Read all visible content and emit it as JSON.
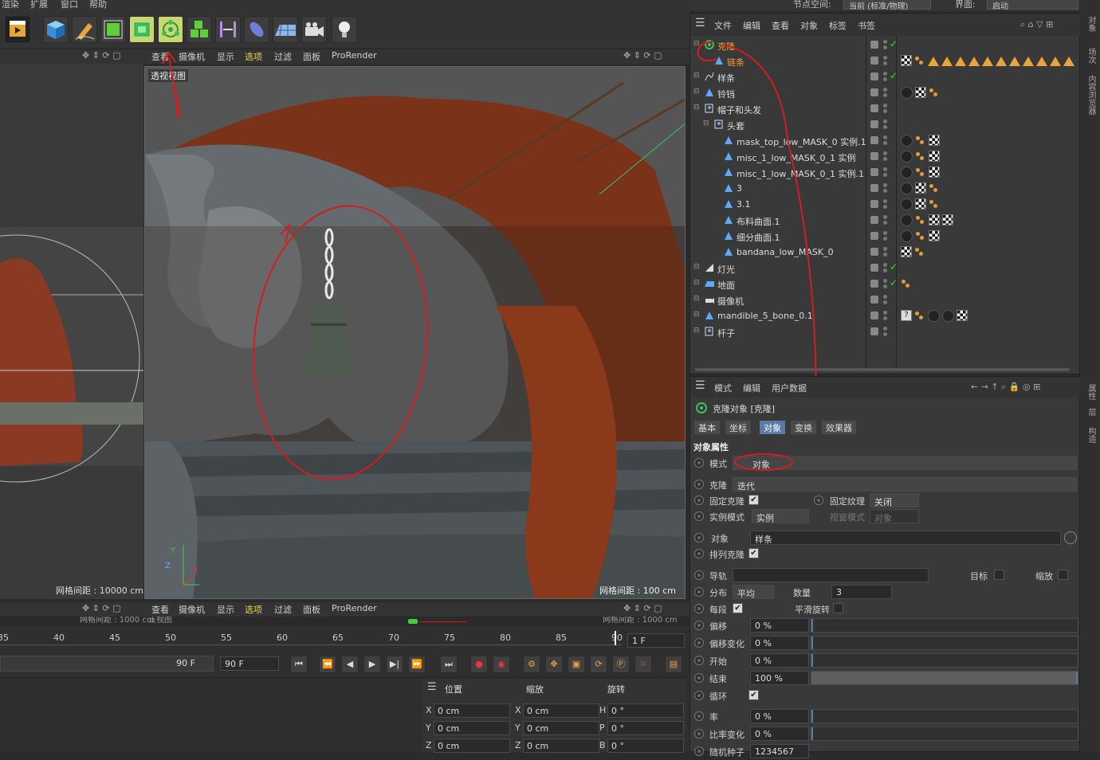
{
  "top_menu": {
    "items": [
      "渲染",
      "扩展",
      "窗口",
      "帮助"
    ]
  },
  "right_header": {
    "node_space_label": "节点空间:",
    "node_space_value": "当前 (标准/物理)",
    "layout_label": "界面:",
    "layout_value": "启动"
  },
  "side_tabs": [
    "对象",
    "场次",
    "内容浏览器",
    "属性",
    "层",
    "构造"
  ],
  "viewport_top": {
    "menu": [
      "查看",
      "摄像机",
      "显示",
      "选项",
      "过滤",
      "面板",
      "ProRender"
    ],
    "label": "透视视图",
    "grid_left": "网格间距 : 10000 cm",
    "grid_right": "网格间距 : 100 cm"
  },
  "viewport_bottom": {
    "menu": [
      "查看",
      "摄像机",
      "显示",
      "选项",
      "过滤",
      "面板",
      "ProRender"
    ],
    "grid_left": "网格间距 : 1000 cm",
    "label": "正视图",
    "grid_right": "网格间距 : 1000 cm"
  },
  "object_manager": {
    "menu": [
      "文件",
      "编辑",
      "查看",
      "对象",
      "标签",
      "书签"
    ],
    "objects": [
      {
        "name": "克隆",
        "indent": 0,
        "color": "#e8a53a",
        "icon": "cloner-icon",
        "check": true,
        "tags": []
      },
      {
        "name": "链条",
        "indent": 1,
        "color": "#e8a53a",
        "icon": "polygon-object-icon",
        "check": false,
        "tags": [
          "ck",
          "dt",
          "tri",
          "tri",
          "tri",
          "tri",
          "tri",
          "tri",
          "tri",
          "tri",
          "tri",
          "tri",
          "tri"
        ]
      },
      {
        "name": "样条",
        "indent": 0,
        "color": "#dddddd",
        "icon": "spline-icon",
        "check": true,
        "tags": []
      },
      {
        "name": "铃铛",
        "indent": 0,
        "color": "#dddddd",
        "icon": "polygon-object-icon",
        "check": false,
        "tags": [
          "tg",
          "ck",
          "dt"
        ]
      },
      {
        "name": "帽子和头发",
        "indent": 0,
        "color": "#dddddd",
        "icon": "null-object-icon",
        "check": false,
        "tags": []
      },
      {
        "name": "头套",
        "indent": 1,
        "color": "#dddddd",
        "icon": "null-object-icon",
        "check": false,
        "tags": []
      },
      {
        "name": "mask_top_low_MASK_0 实例.1",
        "indent": 2,
        "color": "#dddddd",
        "icon": "polygon-object-icon",
        "check": false,
        "tags": [
          "tg",
          "dt",
          "ck"
        ]
      },
      {
        "name": "misc_1_low_MASK_0_1 实例",
        "indent": 2,
        "color": "#dddddd",
        "icon": "polygon-object-icon",
        "check": false,
        "tags": [
          "tg",
          "dt",
          "ck"
        ]
      },
      {
        "name": "misc_1_low_MASK_0_1 实例.1",
        "indent": 2,
        "color": "#dddddd",
        "icon": "polygon-object-icon",
        "check": false,
        "tags": [
          "tg",
          "dt",
          "ck"
        ]
      },
      {
        "name": "3",
        "indent": 2,
        "color": "#dddddd",
        "icon": "polygon-object-icon",
        "check": false,
        "tags": [
          "tg",
          "ck",
          "dt"
        ]
      },
      {
        "name": "3.1",
        "indent": 2,
        "color": "#dddddd",
        "icon": "polygon-object-icon",
        "check": false,
        "tags": [
          "tg",
          "ck",
          "dt"
        ]
      },
      {
        "name": "布料曲面.1",
        "indent": 2,
        "color": "#dddddd",
        "icon": "polygon-object-icon",
        "check": false,
        "tags": [
          "tg",
          "dt",
          "ck",
          "ck"
        ]
      },
      {
        "name": "细分曲面.1",
        "indent": 2,
        "color": "#dddddd",
        "icon": "polygon-object-icon",
        "check": false,
        "tags": [
          "tg",
          "dt",
          "ck"
        ]
      },
      {
        "name": "bandana_low_MASK_0",
        "indent": 2,
        "color": "#dddddd",
        "icon": "polygon-object-icon",
        "check": false,
        "tags": [
          "ck",
          "dt"
        ]
      },
      {
        "name": "灯光",
        "indent": 0,
        "color": "#dddddd",
        "icon": "light-icon",
        "check": true,
        "tags": []
      },
      {
        "name": "地面",
        "indent": 0,
        "color": "#dddddd",
        "icon": "floor-icon",
        "check": true,
        "tags": [
          "dt"
        ]
      },
      {
        "name": "摄像机",
        "indent": 0,
        "color": "#dddddd",
        "icon": "camera-icon",
        "check": false,
        "tags": []
      },
      {
        "name": "mandible_5_bone_0.1",
        "indent": 0,
        "color": "#dddddd",
        "icon": "polygon-object-icon",
        "check": false,
        "tags": [
          "q",
          "dt",
          "tg",
          "tg",
          "ck"
        ]
      },
      {
        "name": "杆子",
        "indent": 0,
        "color": "#dddddd",
        "icon": "null-object-icon",
        "check": false,
        "tags": []
      }
    ]
  },
  "attribute_manager": {
    "menu": [
      "模式",
      "编辑",
      "用户数据"
    ],
    "title": "克隆对象 [克隆]",
    "tabs": [
      "基本",
      "坐标",
      "对象",
      "变换",
      "效果器"
    ],
    "active_tab": "对象",
    "section": "对象属性",
    "mode_label": "模式",
    "mode_value": "对象",
    "clone_label": "克隆",
    "clone_value": "迭代",
    "fix_clone_label": "固定克隆",
    "fix_texture_label": "固定纹理",
    "fix_texture_value": "关闭",
    "instance_mode_label": "实例模式",
    "instance_mode_value": "实例",
    "viewport_mode_label": "视窗模式",
    "viewport_mode_value": "对象",
    "object_label": "对象",
    "object_value": "样条",
    "sort_label": "排列克隆",
    "rail_label": "导轨",
    "target_label": "目标",
    "scale_label": "缩放",
    "distribution_label": "分布",
    "distribution_value": "平均",
    "count_label": "数量",
    "count_value": "3",
    "per_segment_label": "每段",
    "smooth_rotation_label": "平滑旋转",
    "offset_label": "偏移",
    "offset_value": "0 %",
    "offset_var_label": "偏移变化",
    "offset_var_value": "0 %",
    "start_label": "开始",
    "start_value": "0 %",
    "end_label": "结束",
    "end_value": "100 %",
    "end_fraction": 1.0,
    "loop_label": "循环",
    "rate_label": "率",
    "rate_value": "0 %",
    "rate_var_label": "比率变化",
    "rate_var_value": "0 %",
    "seed_label": "随机种子",
    "seed_value": "1234567"
  },
  "timeline": {
    "ticks": [
      "35",
      "40",
      "45",
      "50",
      "55",
      "60",
      "65",
      "70",
      "75",
      "80",
      "85",
      "90"
    ],
    "current_frame": "1 F",
    "end_frame_left": "90 F",
    "end_frame": "90 F"
  },
  "coordinates": {
    "headers": [
      "位置",
      "缩放",
      "旋转"
    ],
    "rows": [
      {
        "a": "X",
        "av": "0 cm",
        "b": "X",
        "bv": "0 cm",
        "c": "H",
        "cv": "0 °"
      },
      {
        "a": "Y",
        "av": "0 cm",
        "b": "Y",
        "bv": "0 cm",
        "c": "P",
        "cv": "0 °"
      },
      {
        "a": "Z",
        "av": "0 cm",
        "b": "Z",
        "bv": "0 cm",
        "c": "B",
        "cv": "0 °"
      }
    ]
  },
  "colors": {
    "accent_blue": "#5a7aa8",
    "highlight_yellow": "#c8d86e",
    "annotation_red": "#d21e1e",
    "check_green": "#3fd13f"
  }
}
